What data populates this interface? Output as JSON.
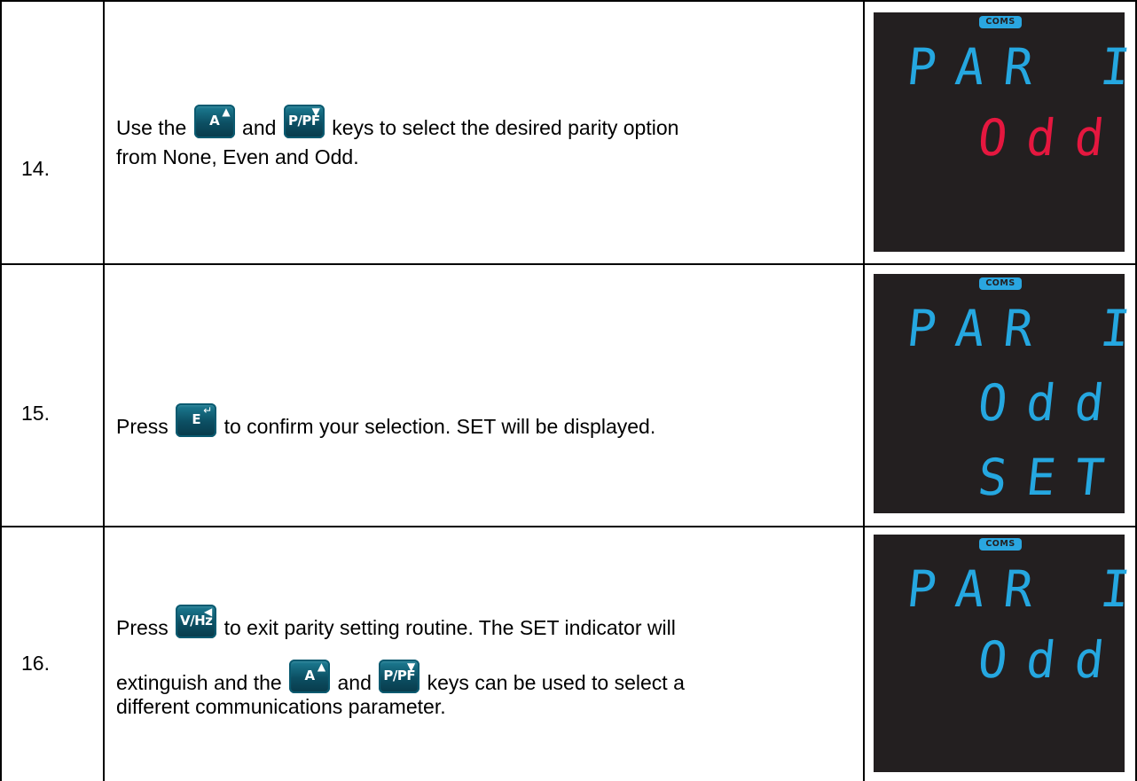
{
  "steps": [
    {
      "number": "14.",
      "text": {
        "l1_a": "Use the",
        "l1_b": "and",
        "l1_c": "keys to select the desired parity option",
        "l2": "from None, Even and Odd."
      },
      "keys": [
        {
          "label": "A",
          "arrow": "▲",
          "icon": "up-arrow-icon"
        },
        {
          "label": "P/PF",
          "arrow": "▼",
          "icon": "down-arrow-icon"
        }
      ],
      "display": {
        "indicator": "COMS",
        "lines": [
          "PAR I",
          "Odd"
        ],
        "line_colors": [
          "#25a7e0",
          "#e5173f"
        ]
      }
    },
    {
      "number": "15.",
      "text": {
        "l1_a": "Press",
        "l1_b": "to confirm your selection.  SET will be displayed."
      },
      "keys": [
        {
          "label": "E",
          "arrow": "↵",
          "icon": "enter-icon"
        }
      ],
      "display": {
        "indicator": "COMS",
        "lines": [
          "PAR I",
          "Odd",
          "SET"
        ],
        "line_colors": [
          "#25a7e0",
          "#25a7e0",
          "#25a7e0"
        ]
      }
    },
    {
      "number": "16.",
      "text": {
        "l1_a": "Press",
        "l1_b": "to exit parity setting routine.  The SET indicator will",
        "l2_a": "extinguish and the",
        "l2_b": "and",
        "l2_c": "keys can be used to select a",
        "l3": "different communications parameter."
      },
      "keys": [
        {
          "label": "V/Hz",
          "arrow": "◀",
          "icon": "left-arrow-icon"
        },
        {
          "label": "A",
          "arrow": "▲",
          "icon": "up-arrow-icon"
        },
        {
          "label": "P/PF",
          "arrow": "▼",
          "icon": "down-arrow-icon"
        }
      ],
      "display": {
        "indicator": "COMS",
        "lines": [
          "PAR I",
          "Odd"
        ],
        "line_colors": [
          "#25a7e0",
          "#25a7e0"
        ]
      }
    }
  ]
}
